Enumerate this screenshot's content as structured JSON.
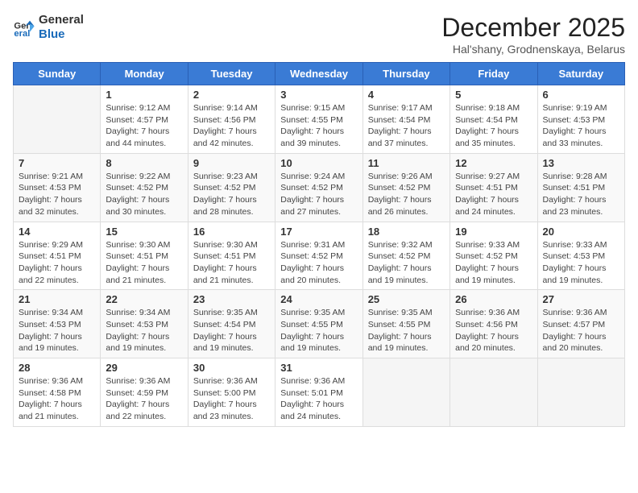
{
  "header": {
    "logo_line1": "General",
    "logo_line2": "Blue",
    "month": "December 2025",
    "location": "Hal'shany, Grodnenskaya, Belarus"
  },
  "days_of_week": [
    "Sunday",
    "Monday",
    "Tuesday",
    "Wednesday",
    "Thursday",
    "Friday",
    "Saturday"
  ],
  "weeks": [
    [
      {
        "day": "",
        "info": ""
      },
      {
        "day": "1",
        "info": "Sunrise: 9:12 AM\nSunset: 4:57 PM\nDaylight: 7 hours\nand 44 minutes."
      },
      {
        "day": "2",
        "info": "Sunrise: 9:14 AM\nSunset: 4:56 PM\nDaylight: 7 hours\nand 42 minutes."
      },
      {
        "day": "3",
        "info": "Sunrise: 9:15 AM\nSunset: 4:55 PM\nDaylight: 7 hours\nand 39 minutes."
      },
      {
        "day": "4",
        "info": "Sunrise: 9:17 AM\nSunset: 4:54 PM\nDaylight: 7 hours\nand 37 minutes."
      },
      {
        "day": "5",
        "info": "Sunrise: 9:18 AM\nSunset: 4:54 PM\nDaylight: 7 hours\nand 35 minutes."
      },
      {
        "day": "6",
        "info": "Sunrise: 9:19 AM\nSunset: 4:53 PM\nDaylight: 7 hours\nand 33 minutes."
      }
    ],
    [
      {
        "day": "7",
        "info": "Sunrise: 9:21 AM\nSunset: 4:53 PM\nDaylight: 7 hours\nand 32 minutes."
      },
      {
        "day": "8",
        "info": "Sunrise: 9:22 AM\nSunset: 4:52 PM\nDaylight: 7 hours\nand 30 minutes."
      },
      {
        "day": "9",
        "info": "Sunrise: 9:23 AM\nSunset: 4:52 PM\nDaylight: 7 hours\nand 28 minutes."
      },
      {
        "day": "10",
        "info": "Sunrise: 9:24 AM\nSunset: 4:52 PM\nDaylight: 7 hours\nand 27 minutes."
      },
      {
        "day": "11",
        "info": "Sunrise: 9:26 AM\nSunset: 4:52 PM\nDaylight: 7 hours\nand 26 minutes."
      },
      {
        "day": "12",
        "info": "Sunrise: 9:27 AM\nSunset: 4:51 PM\nDaylight: 7 hours\nand 24 minutes."
      },
      {
        "day": "13",
        "info": "Sunrise: 9:28 AM\nSunset: 4:51 PM\nDaylight: 7 hours\nand 23 minutes."
      }
    ],
    [
      {
        "day": "14",
        "info": "Sunrise: 9:29 AM\nSunset: 4:51 PM\nDaylight: 7 hours\nand 22 minutes."
      },
      {
        "day": "15",
        "info": "Sunrise: 9:30 AM\nSunset: 4:51 PM\nDaylight: 7 hours\nand 21 minutes."
      },
      {
        "day": "16",
        "info": "Sunrise: 9:30 AM\nSunset: 4:51 PM\nDaylight: 7 hours\nand 21 minutes."
      },
      {
        "day": "17",
        "info": "Sunrise: 9:31 AM\nSunset: 4:52 PM\nDaylight: 7 hours\nand 20 minutes."
      },
      {
        "day": "18",
        "info": "Sunrise: 9:32 AM\nSunset: 4:52 PM\nDaylight: 7 hours\nand 19 minutes."
      },
      {
        "day": "19",
        "info": "Sunrise: 9:33 AM\nSunset: 4:52 PM\nDaylight: 7 hours\nand 19 minutes."
      },
      {
        "day": "20",
        "info": "Sunrise: 9:33 AM\nSunset: 4:53 PM\nDaylight: 7 hours\nand 19 minutes."
      }
    ],
    [
      {
        "day": "21",
        "info": "Sunrise: 9:34 AM\nSunset: 4:53 PM\nDaylight: 7 hours\nand 19 minutes."
      },
      {
        "day": "22",
        "info": "Sunrise: 9:34 AM\nSunset: 4:53 PM\nDaylight: 7 hours\nand 19 minutes."
      },
      {
        "day": "23",
        "info": "Sunrise: 9:35 AM\nSunset: 4:54 PM\nDaylight: 7 hours\nand 19 minutes."
      },
      {
        "day": "24",
        "info": "Sunrise: 9:35 AM\nSunset: 4:55 PM\nDaylight: 7 hours\nand 19 minutes."
      },
      {
        "day": "25",
        "info": "Sunrise: 9:35 AM\nSunset: 4:55 PM\nDaylight: 7 hours\nand 19 minutes."
      },
      {
        "day": "26",
        "info": "Sunrise: 9:36 AM\nSunset: 4:56 PM\nDaylight: 7 hours\nand 20 minutes."
      },
      {
        "day": "27",
        "info": "Sunrise: 9:36 AM\nSunset: 4:57 PM\nDaylight: 7 hours\nand 20 minutes."
      }
    ],
    [
      {
        "day": "28",
        "info": "Sunrise: 9:36 AM\nSunset: 4:58 PM\nDaylight: 7 hours\nand 21 minutes."
      },
      {
        "day": "29",
        "info": "Sunrise: 9:36 AM\nSunset: 4:59 PM\nDaylight: 7 hours\nand 22 minutes."
      },
      {
        "day": "30",
        "info": "Sunrise: 9:36 AM\nSunset: 5:00 PM\nDaylight: 7 hours\nand 23 minutes."
      },
      {
        "day": "31",
        "info": "Sunrise: 9:36 AM\nSunset: 5:01 PM\nDaylight: 7 hours\nand 24 minutes."
      },
      {
        "day": "",
        "info": ""
      },
      {
        "day": "",
        "info": ""
      },
      {
        "day": "",
        "info": ""
      }
    ]
  ]
}
